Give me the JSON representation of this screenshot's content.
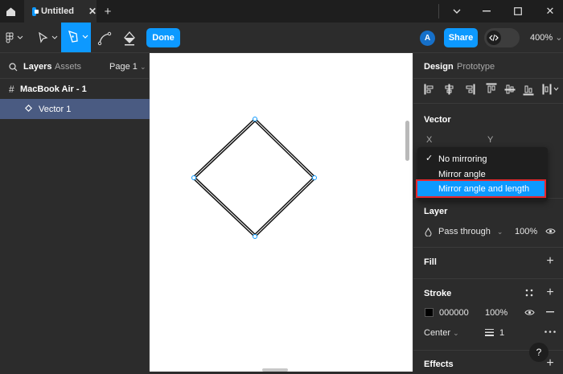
{
  "window": {
    "tab_title": "Untitled",
    "add_tab_symbol": "+"
  },
  "toolbar": {
    "done_label": "Done",
    "avatar_letter": "A",
    "share_label": "Share",
    "zoom": "400%"
  },
  "left_panel": {
    "tabs": [
      "Layers",
      "Assets"
    ],
    "page_label": "Page 1",
    "layers": [
      {
        "name": "MacBook Air - 1",
        "type": "frame"
      },
      {
        "name": "Vector 1",
        "type": "vector",
        "selected": true
      }
    ]
  },
  "right_panel": {
    "tabs": [
      "Design",
      "Prototype"
    ],
    "vector": {
      "title": "Vector",
      "x_label": "X",
      "y_label": "Y"
    },
    "mirroring_menu": {
      "options": [
        "No mirroring",
        "Mirror angle",
        "Mirror angle and length"
      ],
      "checked": "No mirroring",
      "highlighted": "Mirror angle and length"
    },
    "layer": {
      "title": "Layer",
      "blend_mode": "Pass through",
      "opacity": "100%"
    },
    "fill": {
      "title": "Fill"
    },
    "stroke": {
      "title": "Stroke",
      "color_hex": "000000",
      "opacity": "100%",
      "position": "Center",
      "weight": "1"
    },
    "effects": {
      "title": "Effects"
    },
    "help_label": "?"
  },
  "colors": {
    "accent": "#0d99ff",
    "selected_layer_bg": "#4a5b82",
    "highlight_outline": "#e8262c"
  }
}
